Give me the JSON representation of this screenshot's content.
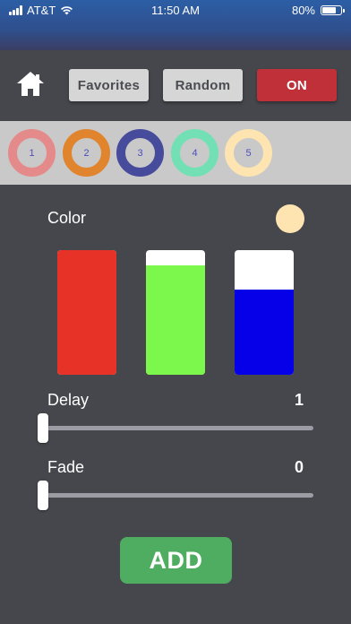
{
  "status_bar": {
    "carrier": "AT&T",
    "time": "11:50 AM",
    "battery_text": "80%",
    "battery_level": 0.8,
    "icons": [
      "signal-bars-icon",
      "wifi-icon",
      "battery-icon"
    ]
  },
  "toolbar": {
    "home_icon": "home-icon",
    "favorites_label": "Favorites",
    "random_label": "Random",
    "power_label": "ON",
    "colors": {
      "button_bg": "#d6d6d6",
      "power_bg": "#c03038"
    }
  },
  "presets": [
    {
      "label": "1",
      "color": "#e58a8a"
    },
    {
      "label": "2",
      "color": "#e0842e"
    },
    {
      "label": "3",
      "color": "#474b9c"
    },
    {
      "label": "4",
      "color": "#72e0b4"
    },
    {
      "label": "5",
      "color": "#fde4b0"
    }
  ],
  "color_section": {
    "label": "Color",
    "swatch_color": "#fde4b0",
    "channels": [
      {
        "name": "red",
        "color": "#e63227",
        "level": 1.0
      },
      {
        "name": "green",
        "color": "#7cf84c",
        "level": 0.88
      },
      {
        "name": "blue",
        "color": "#0600e8",
        "level": 0.68
      }
    ]
  },
  "delay": {
    "label": "Delay",
    "value": "1",
    "position": 0.0
  },
  "fade": {
    "label": "Fade",
    "value": "0",
    "position": 0.0
  },
  "add_button": {
    "label": "ADD",
    "color": "#4ead60"
  }
}
